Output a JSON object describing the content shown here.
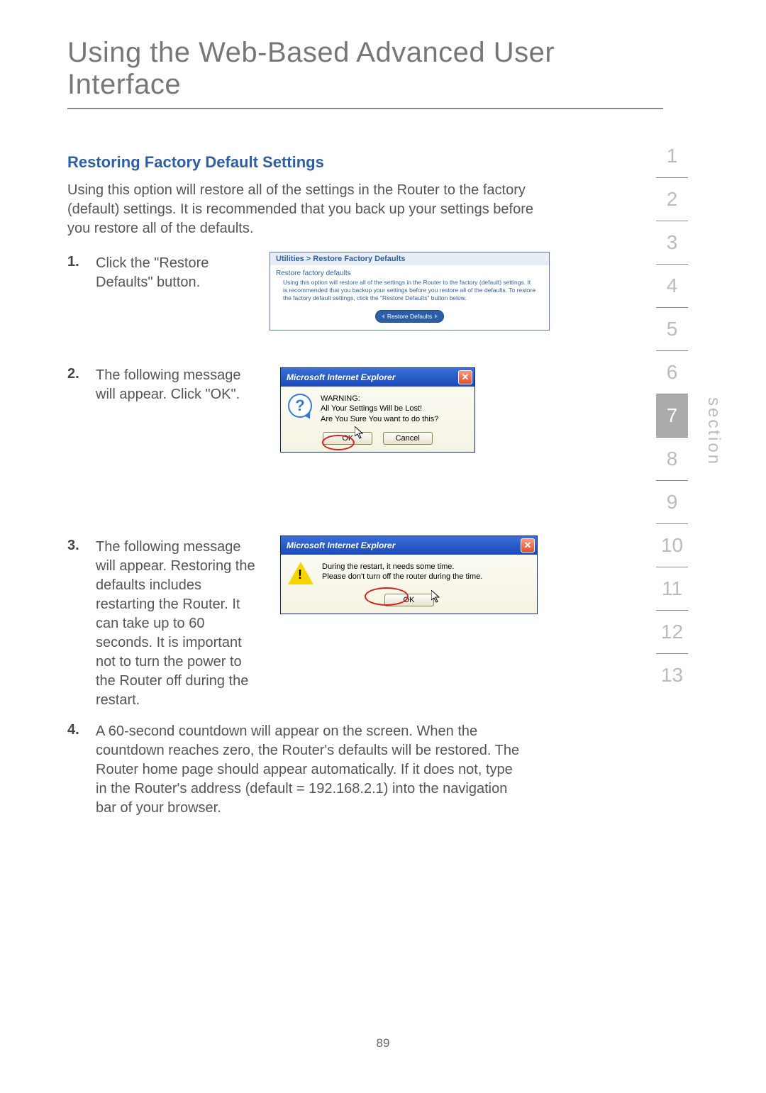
{
  "chapterTitle": "Using the Web-Based Advanced User Interface",
  "sectionNav": {
    "items": [
      "1",
      "2",
      "3",
      "4",
      "5",
      "6",
      "7",
      "8",
      "9",
      "10",
      "11",
      "12",
      "13"
    ],
    "activeIndex": 6,
    "label": "section"
  },
  "subheading": "Restoring Factory Default Settings",
  "intro": "Using this option will restore all of the settings in the Router to the factory (default) settings. It is recommended that you back up your settings before you restore all of the defaults.",
  "steps": [
    {
      "num": "1.",
      "text": "Click the \"Restore Defaults\" button."
    },
    {
      "num": "2.",
      "text": "The following message will appear. Click \"OK\"."
    },
    {
      "num": "3.",
      "text": "The following message will appear. Restoring the defaults includes restarting the Router. It can take up to 60 seconds. It is important not to turn the power to the Router off during the restart."
    },
    {
      "num": "4.",
      "text": "A 60-second countdown will appear on the screen. When the countdown reaches zero, the Router's defaults will be restored. The Router home page should appear automatically. If it does not, type in the Router's address (default = 192.168.2.1) into the navigation bar of your browser."
    }
  ],
  "shot1": {
    "breadcrumb": "Utilities > Restore Factory Defaults",
    "subhead": "Restore factory defaults",
    "body": "Using this option will restore all of the settings in the Router to the factory (default) settings. It is recommended that you backup your settings before you restore all of the defaults. To restore the factory default settings, click the \"Restore Defaults\" button below.",
    "button": "Restore Defaults"
  },
  "shot2": {
    "title": "Microsoft Internet Explorer",
    "line1": "WARNING:",
    "line2": "All Your Settings Will be Lost!",
    "line3": "Are You Sure You want to do this?",
    "ok": "OK",
    "cancel": "Cancel"
  },
  "shot3": {
    "title": "Microsoft Internet Explorer",
    "line1": "During the restart, it needs some time.",
    "line2": "Please don't turn off the router during the time.",
    "ok": "OK"
  },
  "pageNumber": "89"
}
